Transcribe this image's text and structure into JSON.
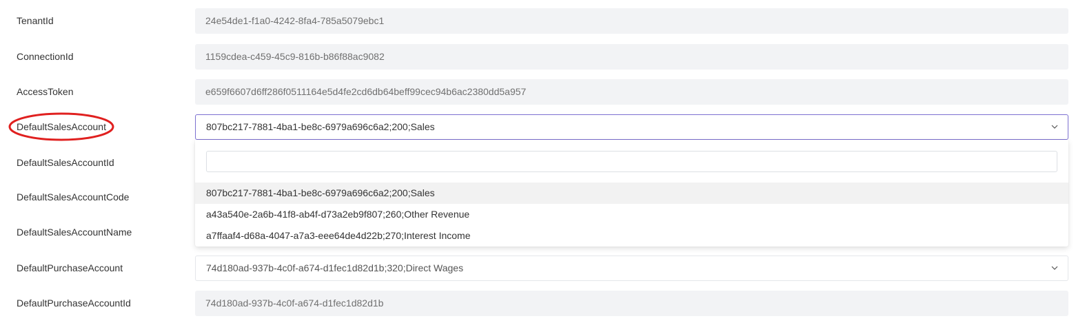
{
  "fields": [
    {
      "label": "TenantId",
      "value": "24e54de1-f1a0-4242-8fa4-785a5079ebc1"
    },
    {
      "label": "ConnectionId",
      "value": "1159cdea-c459-45c9-816b-b86f88ac9082"
    },
    {
      "label": "AccessToken",
      "value": "e659f6607d6ff286f0511164e5d4fe2cd6db64beff99cec94b6ac2380dd5a957"
    }
  ],
  "default_sales_account": {
    "label": "DefaultSalesAccount",
    "selected_value": "807bc217-7881-4ba1-be8c-6979a696c6a2;200;Sales",
    "dropdown": {
      "search_value": "",
      "options": [
        "807bc217-7881-4ba1-be8c-6979a696c6a2;200;Sales",
        "a43a540e-2a6b-41f8-ab4f-d73a2eb9f807;260;Other Revenue",
        "a7ffaaf4-d68a-4047-a7a3-eee64de4d22b;270;Interest Income"
      ],
      "highlighted_index": 0
    }
  },
  "hidden_labels": {
    "account_id": "DefaultSalesAccountId",
    "account_code": "DefaultSalesAccountCode",
    "account_name": "DefaultSalesAccountName"
  },
  "default_purchase_account": {
    "label": "DefaultPurchaseAccount",
    "selected_value": "74d180ad-937b-4c0f-a674-d1fec1d82d1b;320;Direct Wages"
  },
  "default_purchase_account_id": {
    "label": "DefaultPurchaseAccountId",
    "value": "74d180ad-937b-4c0f-a674-d1fec1d82d1b"
  },
  "colors": {
    "annotation": "#e0201f",
    "focus_border": "#7b6fd0",
    "readonly_bg": "#f2f3f5"
  },
  "icons": {
    "select_chevron": "chevron-down-icon"
  }
}
